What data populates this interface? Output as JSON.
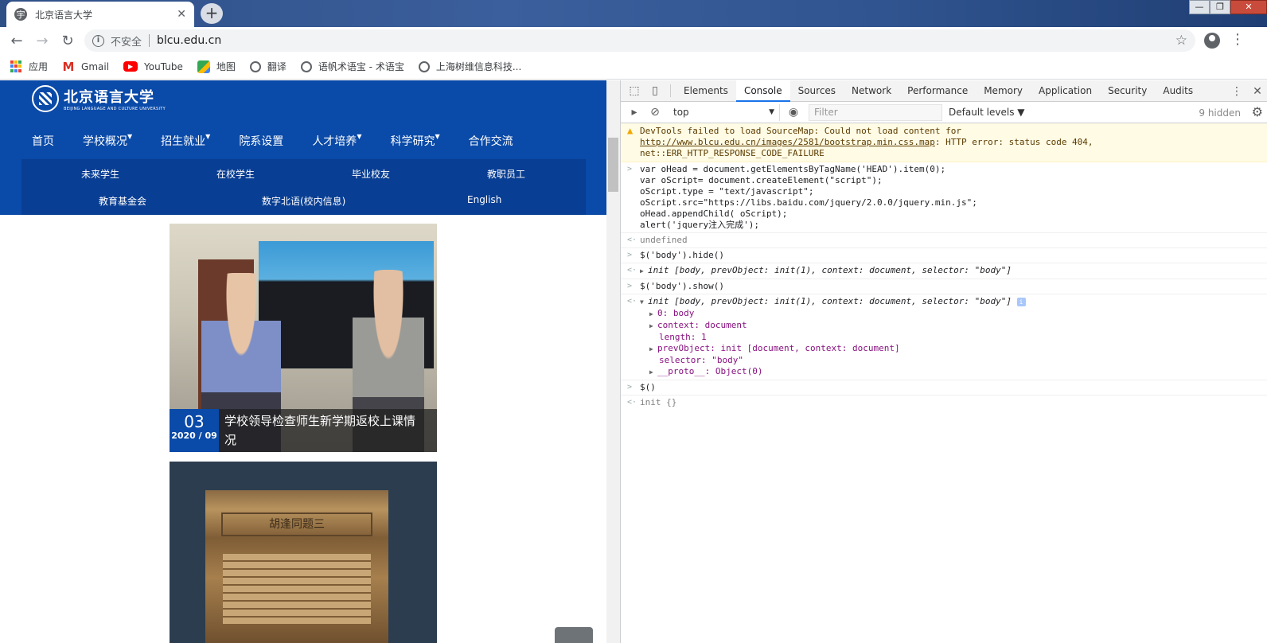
{
  "browser": {
    "tab_title": "北京语言大学",
    "tab_favicon": "宇",
    "new_tab": "+",
    "window_controls": [
      "—",
      "❐",
      "✕"
    ],
    "insecure_label": "不安全",
    "url": "blcu.edu.cn",
    "bookmarks": [
      "应用",
      "Gmail",
      "YouTube",
      "地图",
      "翻译",
      "语帆术语宝 - 术语宝",
      "上海树维信息科技..."
    ]
  },
  "site": {
    "logo_cn": "北京语言大学",
    "logo_en": "BEIJING LANGUAGE AND CULTURE UNIVERSITY",
    "main_nav": [
      "首页",
      "学校概况",
      "招生就业",
      "院系设置",
      "人才培养",
      "科学研究",
      "合作交流"
    ],
    "sub_nav": [
      "未来学生",
      "在校学生",
      "毕业校友",
      "教职员工",
      "教育基金会",
      "数字北语(校内信息)",
      "English"
    ],
    "news": [
      {
        "day": "03",
        "ym": "2020 / 09",
        "title": "学校领导检查师生新学期返校上课情况"
      },
      {
        "box_text": "胡逢同题三"
      }
    ]
  },
  "devtools": {
    "tabs": [
      "Elements",
      "Console",
      "Sources",
      "Network",
      "Performance",
      "Memory",
      "Application",
      "Security",
      "Audits"
    ],
    "active_tab": "Console",
    "context": "top",
    "filter_placeholder": "Filter",
    "levels": "Default levels ▼",
    "hidden": "9 hidden",
    "console": {
      "warning_prefix": "DevTools failed to load SourceMap: Could not load content for ",
      "warning_url": "http://www.blcu.edu.cn/images/2581/bootstrap.min.css.map",
      "warning_suffix": ": HTTP error: status code 404, net::ERR_HTTP_RESPONSE_CODE_FAILURE",
      "code": [
        "var oHead = document.getElementsByTagName('HEAD').item(0);",
        "var oScript= document.createElement(\"script\");",
        "oScript.type = \"text/javascript\";",
        "oScript.src=\"https://libs.baidu.com/jquery/2.0.0/jquery.min.js\";",
        "oHead.appendChild( oScript);",
        "alert('jquery注入完成');"
      ],
      "result1": "undefined",
      "cmd2": "$('body').hide()",
      "result2": "init [body, prevObject: init(1), context: document, selector: \"body\"]",
      "cmd3": "$('body').show()",
      "result3": "init [body, prevObject: init(1), context: document, selector: \"body\"]",
      "result3_props": [
        "0: body",
        "context: document",
        "length: 1",
        "prevObject: init [document, context: document]",
        "selector: \"body\"",
        "__proto__: Object(0)"
      ],
      "cmd4": "$()",
      "result4": "init {}"
    }
  }
}
